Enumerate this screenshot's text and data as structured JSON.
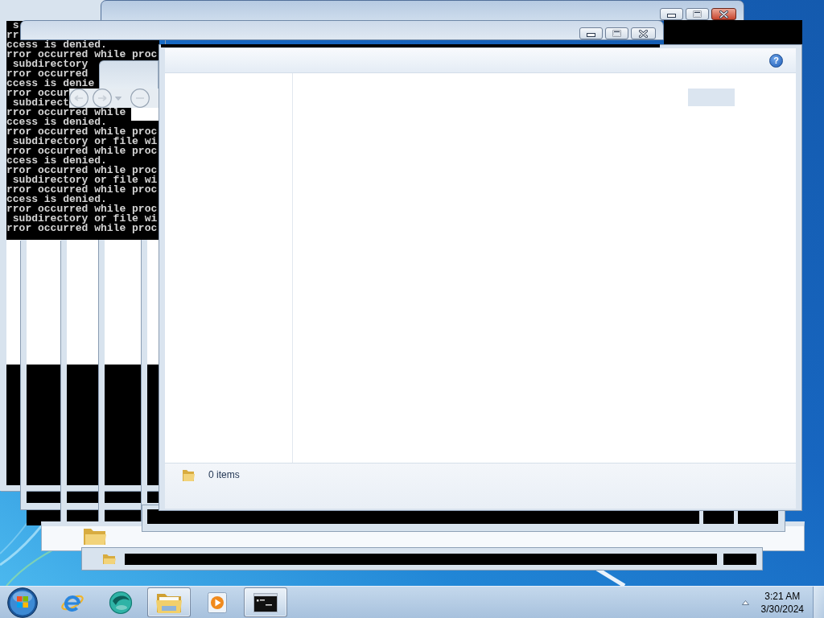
{
  "console": {
    "lines": [
      " s",
      "rr",
      "ccess is denied.",
      "rror occurred while proc",
      " subdirectory",
      "rror occurred",
      "ccess is denie",
      "rror occur",
      " subdirect",
      "rror occurred while",
      "ccess is denied.",
      "rror occurred while proc",
      " subdirectory or file wi",
      "rror occurred while proc",
      "ccess is denied.",
      "rror occurred while proc",
      " subdirectory or file wi",
      "rror occurred while proc",
      "ccess is denied.",
      "rror occurred while proc",
      " subdirectory or file wi",
      "rror occurred while proc"
    ]
  },
  "title_bars": [
    {
      "active": true
    },
    {
      "active": false
    }
  ],
  "explorer": {
    "help_button": {
      "symbol": "?"
    },
    "status_bar": {
      "item_count": "0 items"
    }
  },
  "taskbar": {
    "items": [
      {
        "kind": "browser",
        "running": false
      },
      {
        "kind": "swirl",
        "running": false
      },
      {
        "kind": "folder",
        "running": true
      },
      {
        "kind": "media",
        "running": false
      },
      {
        "kind": "terminal",
        "running": true
      }
    ],
    "clock": {
      "time": "3:21 AM",
      "date": "3/30/2024"
    }
  }
}
